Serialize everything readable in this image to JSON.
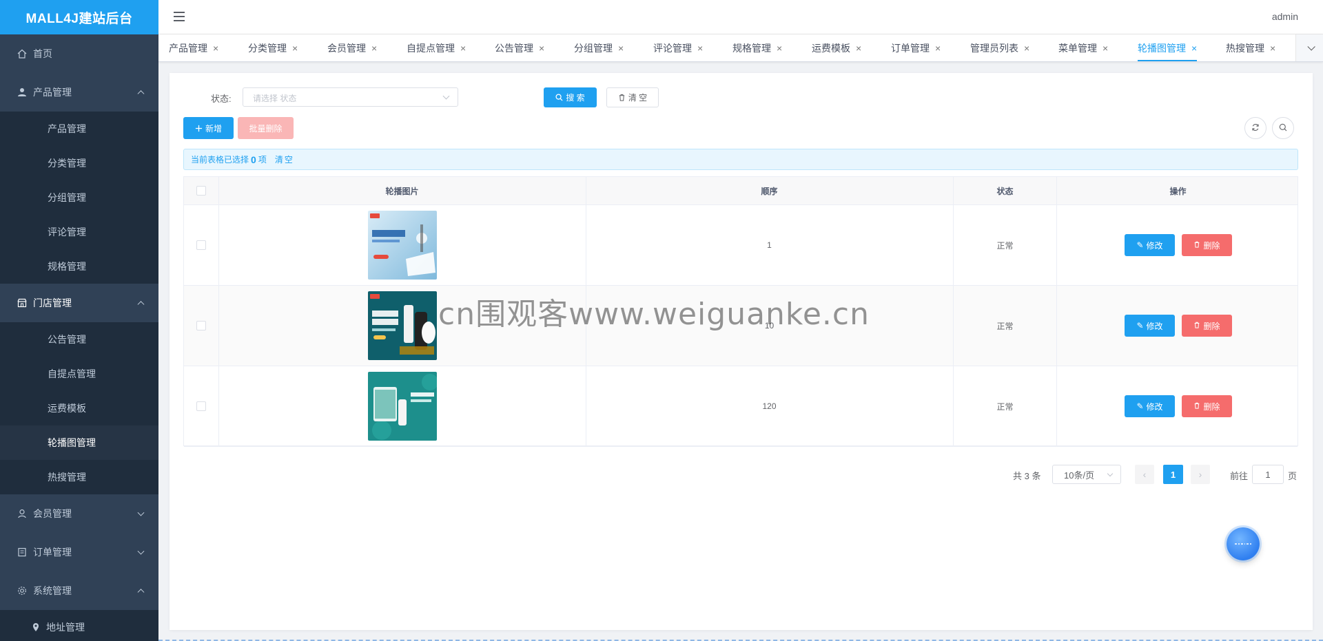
{
  "app": {
    "logo": "MALL4J建站后台",
    "user": "admin"
  },
  "colors": {
    "primary": "#1fa0f0",
    "danger": "#f56c6c",
    "sidebar": "#304156"
  },
  "sidebar": {
    "home": "首页",
    "product_group": "产品管理",
    "product_items": [
      "产品管理",
      "分类管理",
      "分组管理",
      "评论管理",
      "规格管理"
    ],
    "store_group": "门店管理",
    "store_items": [
      "公告管理",
      "自提点管理",
      "运费模板",
      "轮播图管理",
      "热搜管理"
    ],
    "member_group": "会员管理",
    "order_group": "订单管理",
    "system_group": "系统管理",
    "system_items": [
      "地址管理"
    ]
  },
  "tabs": [
    "产品管理",
    "分类管理",
    "会员管理",
    "自提点管理",
    "公告管理",
    "分组管理",
    "评论管理",
    "规格管理",
    "运费模板",
    "订单管理",
    "管理员列表",
    "菜单管理",
    "轮播图管理",
    "热搜管理"
  ],
  "active_tab": "轮播图管理",
  "search": {
    "label": "状态:",
    "placeholder": "请选择 状态",
    "search_button": "搜 索",
    "clear_button": "清 空"
  },
  "toolbar": {
    "add": "新增",
    "batch_delete": "批量删除"
  },
  "selection": {
    "prefix": "当前表格已选择",
    "count": "0",
    "suffix": "项",
    "clear": "清空"
  },
  "table": {
    "headers": [
      "轮播图片",
      "顺序",
      "状态",
      "操作"
    ],
    "edit_label": "修改",
    "delete_label": "删除",
    "rows": [
      {
        "order": "1",
        "status": "正常",
        "image": "banner-phone-gift"
      },
      {
        "order": "10",
        "status": "正常",
        "image": "banner-beauty-skincare"
      },
      {
        "order": "120",
        "status": "正常",
        "image": "banner-teal-giftbox"
      }
    ]
  },
  "pagination": {
    "total": "共 3 条",
    "page_size": "10条/页",
    "current_page": "1",
    "goto_label": "前往",
    "goto_value": "1",
    "goto_suffix": "页"
  },
  "watermark": "cn围观客www.weiguanke.cn"
}
